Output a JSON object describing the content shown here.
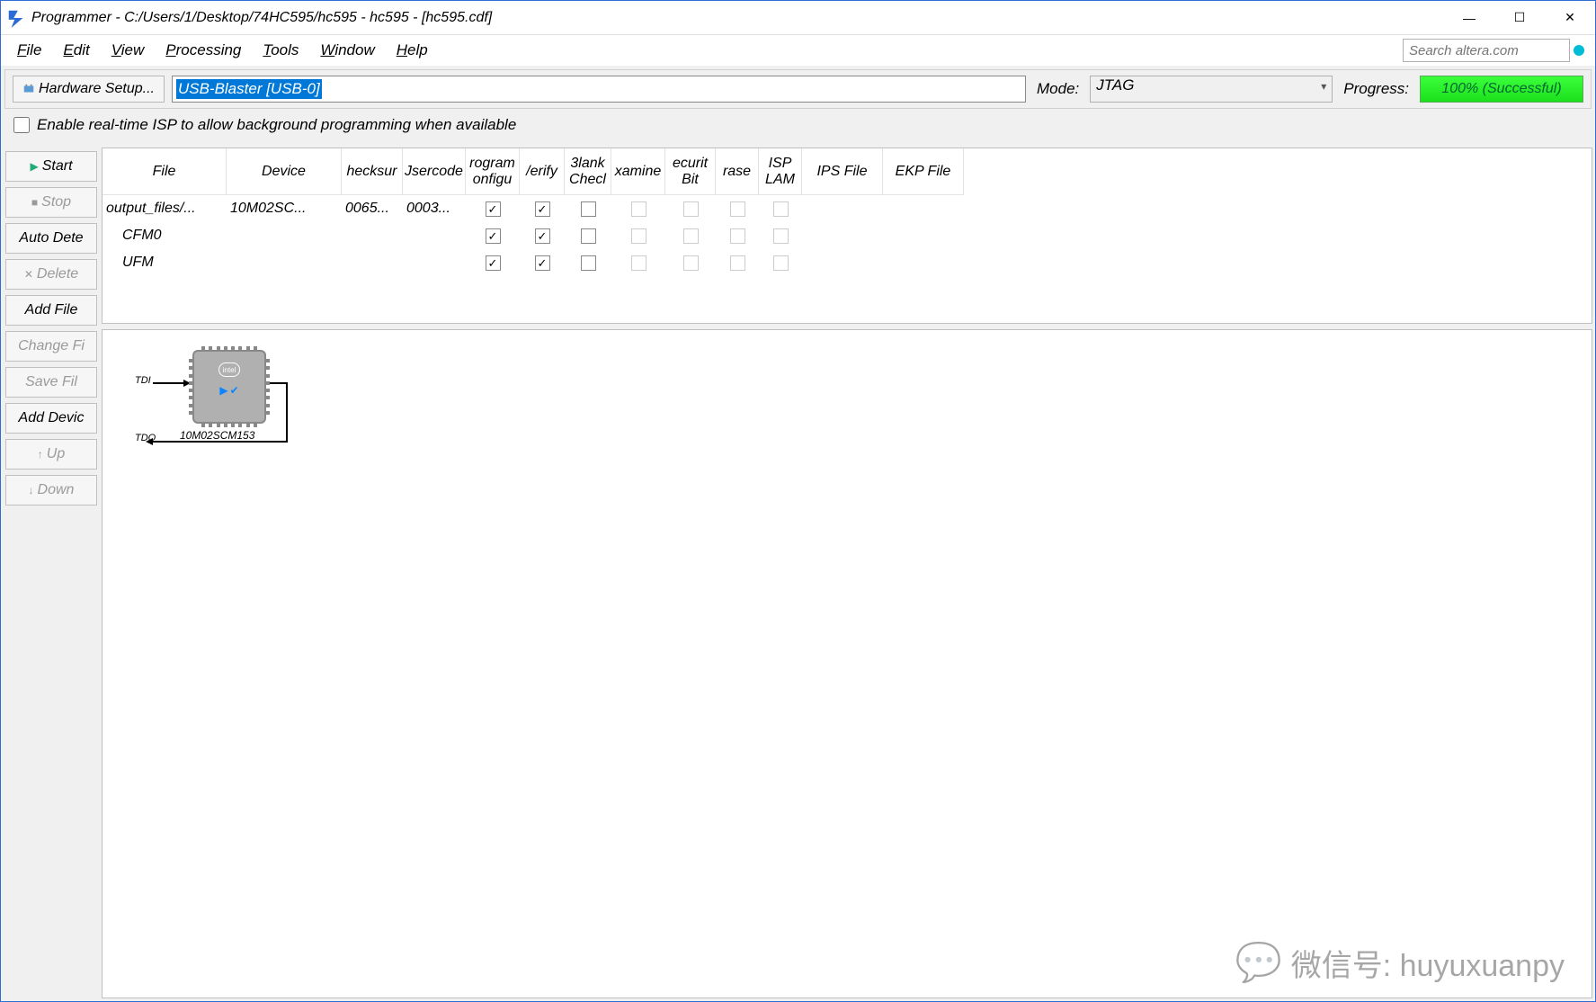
{
  "window_title": "Programmer - C:/Users/1/Desktop/74HC595/hc595 - hc595 - [hc595.cdf]",
  "menu": [
    "File",
    "Edit",
    "View",
    "Processing",
    "Tools",
    "Window",
    "Help"
  ],
  "search_placeholder": "Search altera.com",
  "toolbar": {
    "hardware_setup": "Hardware Setup...",
    "device_text": "USB-Blaster [USB-0]",
    "mode_label": "Mode:",
    "mode_value": "JTAG",
    "progress_label": "Progress:",
    "progress_value": "100% (Successful)"
  },
  "isp_label": "Enable real-time ISP to allow background programming when available",
  "side_buttons": [
    {
      "label": "Start",
      "icon": "▶",
      "disabled": false,
      "color": "#2a7"
    },
    {
      "label": "Stop",
      "icon": "■",
      "disabled": true,
      "color": "#c44"
    },
    {
      "label": "Auto Dete",
      "icon": "",
      "disabled": false
    },
    {
      "label": "Delete",
      "icon": "✕",
      "disabled": true
    },
    {
      "label": "Add File",
      "icon": "",
      "disabled": false
    },
    {
      "label": "Change Fi",
      "icon": "",
      "disabled": true
    },
    {
      "label": "Save Fil",
      "icon": "",
      "disabled": true
    },
    {
      "label": "Add Devic",
      "icon": "",
      "disabled": false
    },
    {
      "label": "Up",
      "icon": "↑",
      "disabled": true
    },
    {
      "label": "Down",
      "icon": "↓",
      "disabled": true
    }
  ],
  "table": {
    "headers": [
      "File",
      "Device",
      "hecksur",
      "Jsercode",
      "rogram\nonfigu",
      "/erify",
      "3lank\nChecl",
      "xamine",
      "ecurit\nBit",
      "rase",
      "ISP\nLAM",
      "IPS File",
      "EKP File"
    ],
    "rows": [
      {
        "file": "output_files/...",
        "device": "10M02SC...",
        "checksum": "0065...",
        "usercode": "0003...",
        "indent": false,
        "checks": [
          true,
          true,
          false,
          null,
          null,
          null,
          null
        ]
      },
      {
        "file": "CFM0",
        "device": "",
        "checksum": "",
        "usercode": "",
        "indent": true,
        "checks": [
          true,
          true,
          false,
          null,
          null,
          null,
          null
        ]
      },
      {
        "file": "UFM",
        "device": "",
        "checksum": "",
        "usercode": "",
        "indent": true,
        "checks": [
          true,
          true,
          false,
          null,
          null,
          null,
          null
        ]
      }
    ]
  },
  "diagram": {
    "tdi": "TDI",
    "tdo": "TDO",
    "chip_label": "10M02SCM153",
    "logo": "intel"
  },
  "watermark": "微信号: huyuxuanpy"
}
